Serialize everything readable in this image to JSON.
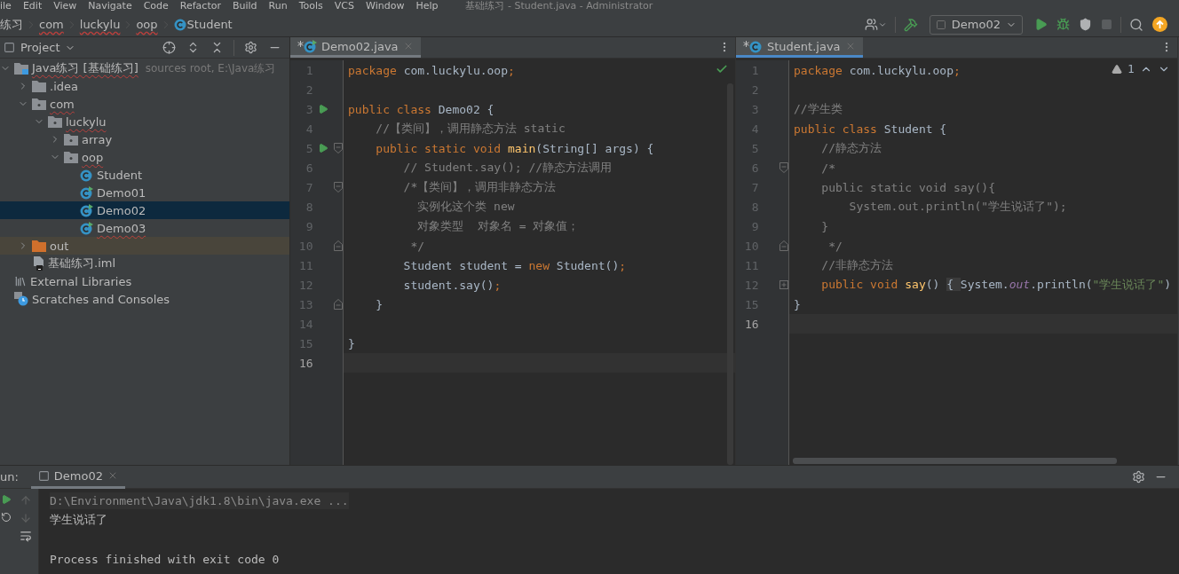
{
  "menu_bar": {
    "items": [
      "ile",
      "Edit",
      "View",
      "Navigate",
      "Code",
      "Refactor",
      "Build",
      "Run",
      "Tools",
      "VCS",
      "Window",
      "Help"
    ],
    "title": "基础练习 - Student.java - Administrator"
  },
  "breadcrumbs": [
    {
      "label": "练习",
      "kind": "module",
      "misspelled": false
    },
    {
      "label": "com",
      "kind": "package",
      "misspelled": true
    },
    {
      "label": "luckylu",
      "kind": "package",
      "misspelled": true
    },
    {
      "label": "oop",
      "kind": "package",
      "misspelled": true
    },
    {
      "label": "Student",
      "kind": "class",
      "misspelled": false
    }
  ],
  "toolbar": {
    "run_config": "Demo02",
    "stop_disabled": true
  },
  "project_panel": {
    "title": "Project",
    "tree": [
      {
        "label": "Java练习 [基础练习]",
        "note": "sources root,  E:\\Java练习",
        "kind": "module",
        "expanded": true,
        "selected": false,
        "misspelled": true,
        "children": [
          {
            "label": ".idea",
            "kind": "folder",
            "expanded": false,
            "selected": false,
            "misspelled": false
          },
          {
            "label": "com",
            "kind": "package",
            "expanded": true,
            "selected": false,
            "misspelled": true,
            "children": [
              {
                "label": "luckylu",
                "kind": "package",
                "expanded": true,
                "selected": false,
                "misspelled": true,
                "children": [
                  {
                    "label": "array",
                    "kind": "package",
                    "expanded": false,
                    "selected": false,
                    "misspelled": false
                  },
                  {
                    "label": "oop",
                    "kind": "package",
                    "expanded": true,
                    "selected": false,
                    "misspelled": true,
                    "children": [
                      {
                        "label": "Student",
                        "kind": "class",
                        "selected": false,
                        "misspelled": false
                      },
                      {
                        "label": "Demo01",
                        "kind": "runclass",
                        "selected": false,
                        "misspelled": false
                      },
                      {
                        "label": "Demo02",
                        "kind": "runclass",
                        "selected": true,
                        "misspelled": false
                      },
                      {
                        "label": "Demo03",
                        "kind": "runclass",
                        "selected": false,
                        "misspelled": true
                      }
                    ]
                  }
                ]
              }
            ]
          },
          {
            "label": "out",
            "kind": "excluded",
            "expanded": false,
            "selected": false,
            "misspelled": false
          },
          {
            "label": "基础练习.iml",
            "kind": "iml",
            "selected": false,
            "misspelled": false
          }
        ]
      },
      {
        "label": "External Libraries",
        "kind": "libraries",
        "selected": false,
        "misspelled": false
      },
      {
        "label": "Scratches and Consoles",
        "kind": "scratches",
        "selected": false,
        "misspelled": false
      }
    ]
  },
  "editors": [
    {
      "tab": {
        "label": "Demo02.java",
        "modified": true,
        "selected": false
      },
      "inspection": {
        "kind": "ok"
      },
      "lines": [
        {
          "number": "1",
          "run": false,
          "current": false,
          "tokens": [
            {
              "kind": "kw",
              "text": "package "
            },
            {
              "kind": "id",
              "text": "com.luckylu.oop"
            },
            {
              "kind": "kw",
              "text": ";"
            }
          ]
        },
        {
          "number": "2",
          "run": false,
          "current": false
        },
        {
          "number": "3",
          "run": true,
          "current": false,
          "tokens": [
            {
              "kind": "kw",
              "text": "public class "
            },
            {
              "kind": "id",
              "text": "Demo02 {"
            }
          ]
        },
        {
          "number": "4",
          "run": false,
          "current": false,
          "tokens": [
            {
              "kind": "cm",
              "text": "    //【类间】，调用静态方法 static"
            }
          ]
        },
        {
          "number": "5",
          "run": true,
          "current": false,
          "fold": {
            "kind": "start"
          },
          "tokens": [
            {
              "kind": "kw",
              "text": "    public static void "
            },
            {
              "kind": "fn",
              "text": "main"
            },
            {
              "kind": "id",
              "text": "(String[] args) {"
            }
          ]
        },
        {
          "number": "6",
          "run": false,
          "current": false,
          "tokens": [
            {
              "kind": "cm",
              "text": "        // Student.say(); //静态方法调用"
            }
          ]
        },
        {
          "number": "7",
          "run": false,
          "current": false,
          "fold": {
            "kind": "start"
          },
          "tokens": [
            {
              "kind": "cm",
              "text": "        /*【类间】，调用非静态方法"
            }
          ]
        },
        {
          "number": "8",
          "run": false,
          "current": false,
          "tokens": [
            {
              "kind": "cm",
              "text": "          实例化这个类 new"
            }
          ]
        },
        {
          "number": "9",
          "run": false,
          "current": false,
          "tokens": [
            {
              "kind": "cm",
              "text": "          对象类型  对象名 = 对象值；"
            }
          ]
        },
        {
          "number": "10",
          "run": false,
          "current": false,
          "fold": {
            "kind": "end"
          },
          "tokens": [
            {
              "kind": "cm",
              "text": "         */"
            }
          ]
        },
        {
          "number": "11",
          "run": false,
          "current": false,
          "tokens": [
            {
              "kind": "id",
              "text": "        Student student = "
            },
            {
              "kind": "kw",
              "text": "new "
            },
            {
              "kind": "id",
              "text": "Student()"
            },
            {
              "kind": "kw",
              "text": ";"
            }
          ]
        },
        {
          "number": "12",
          "run": false,
          "current": false,
          "tokens": [
            {
              "kind": "id",
              "text": "        student.say()"
            },
            {
              "kind": "kw",
              "text": ";"
            }
          ]
        },
        {
          "number": "13",
          "run": false,
          "current": false,
          "fold": {
            "kind": "end"
          },
          "tokens": [
            {
              "kind": "id",
              "text": "    }"
            }
          ]
        },
        {
          "number": "14",
          "run": false,
          "current": false
        },
        {
          "number": "15",
          "run": false,
          "current": false,
          "tokens": [
            {
              "kind": "id",
              "text": "}"
            }
          ]
        },
        {
          "number": "16",
          "run": false,
          "current": true
        }
      ]
    },
    {
      "tab": {
        "label": "Student.java",
        "modified": true,
        "selected": true
      },
      "inspection": {
        "kind": "warning",
        "count": "1"
      },
      "lines": [
        {
          "number": "1",
          "run": false,
          "current": false,
          "tokens": [
            {
              "kind": "kw",
              "text": "package "
            },
            {
              "kind": "id",
              "text": "com.luckylu.oop"
            },
            {
              "kind": "kw",
              "text": ";"
            }
          ]
        },
        {
          "number": "2",
          "run": false,
          "current": false
        },
        {
          "number": "3",
          "run": false,
          "current": false,
          "tokens": [
            {
              "kind": "cm",
              "text": "//学生类"
            }
          ]
        },
        {
          "number": "4",
          "run": false,
          "current": false,
          "tokens": [
            {
              "kind": "kw",
              "text": "public class "
            },
            {
              "kind": "id",
              "text": "Student {"
            }
          ]
        },
        {
          "number": "5",
          "run": false,
          "current": false,
          "tokens": [
            {
              "kind": "cm",
              "text": "    //静态方法"
            }
          ]
        },
        {
          "number": "6",
          "run": false,
          "current": false,
          "fold": {
            "kind": "start"
          },
          "tokens": [
            {
              "kind": "cm",
              "text": "    /*"
            }
          ]
        },
        {
          "number": "7",
          "run": false,
          "current": false,
          "tokens": [
            {
              "kind": "cm",
              "text": "    public static void say(){"
            }
          ]
        },
        {
          "number": "8",
          "run": false,
          "current": false,
          "tokens": [
            {
              "kind": "cm",
              "text": "        System.out.println(\"学生说话了\");"
            }
          ]
        },
        {
          "number": "9",
          "run": false,
          "current": false,
          "tokens": [
            {
              "kind": "cm",
              "text": "    }"
            }
          ]
        },
        {
          "number": "10",
          "run": false,
          "current": false,
          "fold": {
            "kind": "end"
          },
          "tokens": [
            {
              "kind": "cm",
              "text": "     */"
            }
          ]
        },
        {
          "number": "11",
          "run": false,
          "current": false,
          "tokens": [
            {
              "kind": "cm",
              "text": "    //非静态方法"
            }
          ]
        },
        {
          "number": "12",
          "run": false,
          "current": false,
          "fold": {
            "kind": "collapsed"
          },
          "tokens": [
            {
              "kind": "kw",
              "text": "    public void "
            },
            {
              "kind": "fn",
              "text": "say"
            },
            {
              "kind": "id",
              "text": "() "
            },
            {
              "kind": "folded",
              "text": "{ "
            },
            {
              "kind": "id",
              "text": "System."
            },
            {
              "kind": "fld",
              "text": "out"
            },
            {
              "kind": "id",
              "text": ".println("
            },
            {
              "kind": "str",
              "text": "\"学生说话了\""
            },
            {
              "kind": "id",
              "text": ")"
            }
          ]
        },
        {
          "number": "15",
          "run": false,
          "current": false,
          "tokens": [
            {
              "kind": "id",
              "text": "}"
            }
          ]
        },
        {
          "number": "16",
          "run": false,
          "current": true
        }
      ]
    }
  ],
  "run_panel": {
    "label": "un:",
    "tab": "Demo02",
    "console": [
      {
        "kind": "command",
        "text": "D:\\Environment\\Java\\jdk1.8\\bin\\java.exe ..."
      },
      {
        "kind": "output",
        "text": "学生说话了"
      },
      {
        "kind": "blank"
      },
      {
        "kind": "output",
        "text": "Process finished with exit code 0"
      }
    ]
  }
}
